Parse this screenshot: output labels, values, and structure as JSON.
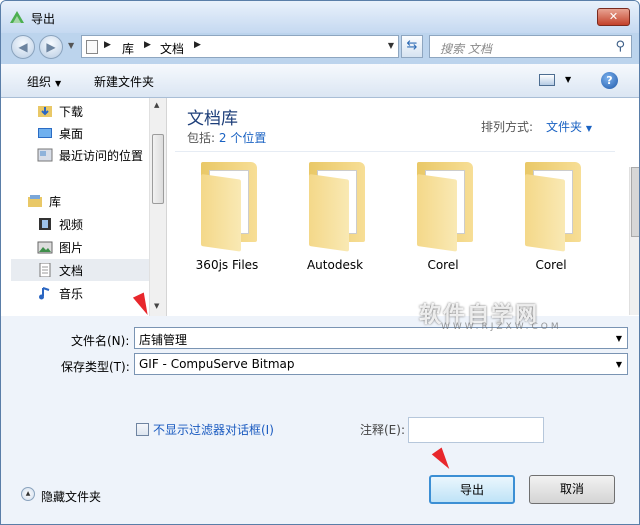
{
  "window": {
    "title": "导出",
    "close_label": "✕"
  },
  "nav": {
    "breadcrumbs": [
      "库",
      "文档"
    ],
    "search_placeholder": "搜索 文档"
  },
  "toolbar": {
    "organize": "组织",
    "new_folder": "新建文件夹"
  },
  "sidebar": {
    "items": [
      {
        "label": "下载"
      },
      {
        "label": "桌面"
      },
      {
        "label": "最近访问的位置"
      },
      {
        "label": "库"
      },
      {
        "label": "视频"
      },
      {
        "label": "图片"
      },
      {
        "label": "文档"
      },
      {
        "label": "音乐"
      }
    ],
    "selected": "文档"
  },
  "library": {
    "title": "文档库",
    "includes_prefix": "包括:",
    "includes_link": "2 个位置",
    "sort_label": "排列方式:",
    "sort_value": "文件夹"
  },
  "folders": [
    {
      "name": "360js Files"
    },
    {
      "name": "Autodesk"
    },
    {
      "name": "Corel"
    },
    {
      "name": "Corel"
    }
  ],
  "form": {
    "filename_label": "文件名(N):",
    "filename_value": "店铺管理",
    "filetype_label": "保存类型(T):",
    "filetype_value": "GIF - CompuServe Bitmap",
    "no_filter_dialog_label": "不显示过滤器对话框(I)",
    "note_label": "注释(E):",
    "note_value": ""
  },
  "footer": {
    "hide_folders": "隐藏文件夹",
    "export_button": "导出",
    "cancel_button": "取消"
  },
  "watermark": {
    "text": "软件自学网",
    "sub": "WWW.RJZXW.COM"
  },
  "colors": {
    "accent": "#1b63c3",
    "arrow": "#e8272c",
    "titlebar": "#c5d9f1"
  }
}
